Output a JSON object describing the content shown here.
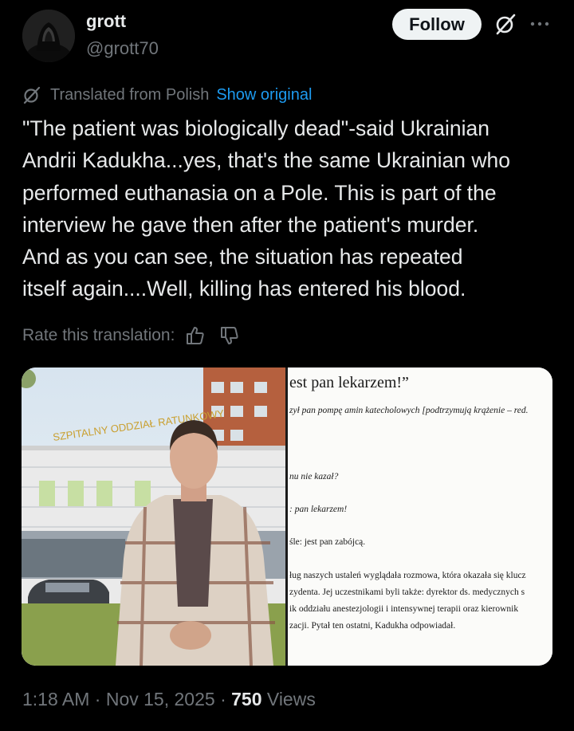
{
  "author": {
    "display_name": "grott",
    "handle": "@grott70",
    "follow_label": "Follow"
  },
  "translation": {
    "notice": "Translated from Polish",
    "show_original": "Show original"
  },
  "tweet": {
    "lines": [
      "\"The patient was biologically dead\"-said Ukrainian",
      "Andrii Kadukha...yes, that's the same Ukrainian who",
      "performed euthanasia on a Pole. This is part of the",
      "interview he gave then after the patient's murder.",
      "And as you can see, the situation has repeated",
      "itself again....Well, killing has entered his blood."
    ]
  },
  "rate": {
    "label": "Rate this translation:"
  },
  "media": {
    "building_sign": "SZPITALNY ODDZIAŁ RATUNKOWY",
    "document": {
      "heading": "est pan lekarzem!”",
      "line1": "zył pan pompę amin katecholowych [podtrzymują krążenie – red.",
      "line2": "nu nie kazał?",
      "line3": ": pan lekarzem!",
      "line4": "śle: jest pan zabójcą.",
      "para": [
        "ług naszych ustaleń wyglądała rozmowa, która okazała się klucz",
        "zydenta. Jej uczestnikami byli także: dyrektor ds. medycznych s",
        "ik oddziału anestezjologii i intensywnej terapii oraz kierownik",
        "zacji. Pytał ten ostatni, Kadukha odpowiadał."
      ]
    }
  },
  "meta": {
    "time": "1:18 AM",
    "date": "Nov 15, 2025",
    "views_count": "750",
    "views_label": "Views"
  },
  "colors": {
    "background": "#000000",
    "text": "#e7e9ea",
    "secondary": "#71767b",
    "link": "#1d9bf0",
    "follow_bg": "#eff3f4"
  },
  "icons": {
    "grok": "grok-icon",
    "more": "more-icon",
    "translate": "grok-translate-icon",
    "thumbs_up": "thumbs-up-icon",
    "thumbs_down": "thumbs-down-icon"
  }
}
